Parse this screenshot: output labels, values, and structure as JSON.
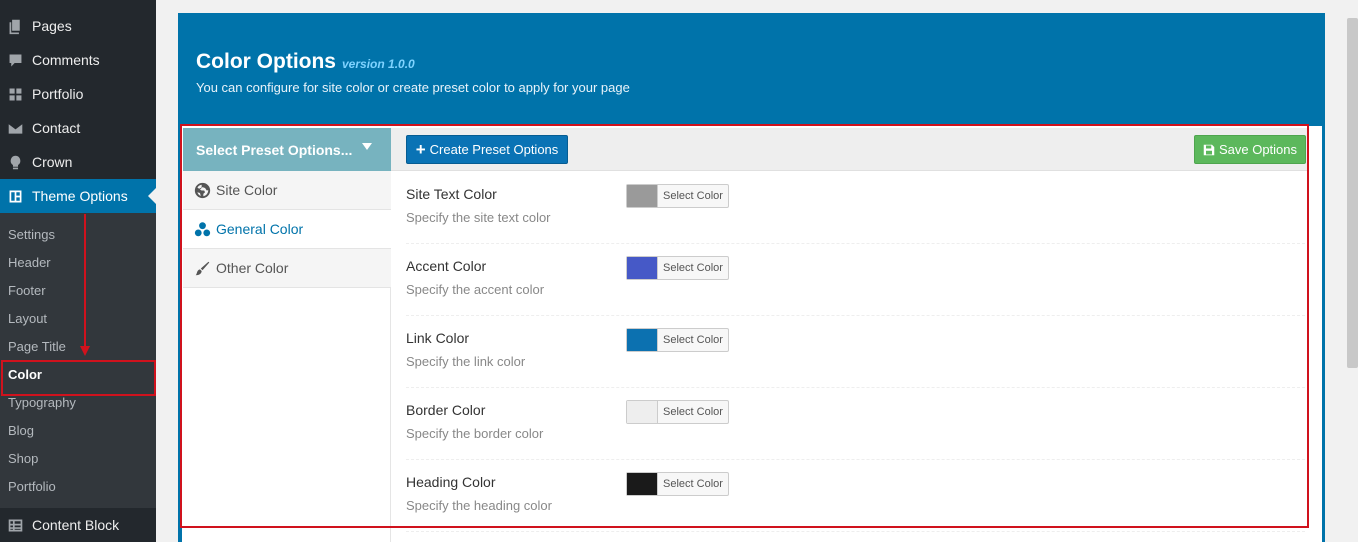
{
  "sidebar": {
    "menu": [
      {
        "label": "Pages",
        "icon": "pages-icon"
      },
      {
        "label": "Comments",
        "icon": "comment-icon"
      },
      {
        "label": "Portfolio",
        "icon": "grid-icon"
      },
      {
        "label": "Contact",
        "icon": "envelope-icon"
      },
      {
        "label": "Crown",
        "icon": "lightbulb-icon"
      },
      {
        "label": "Theme Options",
        "icon": "layout-icon",
        "current": true
      }
    ],
    "submenu": [
      "Settings",
      "Header",
      "Footer",
      "Layout",
      "Page Title",
      "Color",
      "Typography",
      "Blog",
      "Shop",
      "Portfolio"
    ],
    "active_submenu": "Color",
    "bottom_menu": {
      "label": "Content Block",
      "icon": "table-icon"
    }
  },
  "header": {
    "title": "Color Options",
    "version": "version 1.0.0",
    "description": "You can configure for site color or create preset color to apply for your page"
  },
  "toolbar": {
    "preset_select": "Select Preset Options...",
    "create_button": "Create Preset Options",
    "save_button": "Save Options"
  },
  "tabs": [
    {
      "label": "Site Color",
      "icon": "globe-icon",
      "active": false
    },
    {
      "label": "General Color",
      "icon": "circles-icon",
      "active": true
    },
    {
      "label": "Other Color",
      "icon": "brush-icon",
      "active": false
    }
  ],
  "options": [
    {
      "title": "Site Text Color",
      "description": "Specify the site text color",
      "color": "#9a9a9a",
      "picker_label": "Select Color"
    },
    {
      "title": "Accent Color",
      "description": "Specify the accent color",
      "color": "#4659c7",
      "picker_label": "Select Color"
    },
    {
      "title": "Link Color",
      "description": "Specify the link color",
      "color": "#0c71b0",
      "picker_label": "Select Color"
    },
    {
      "title": "Border Color",
      "description": "Specify the border color",
      "color": "#eeeeee",
      "picker_label": "Select Color"
    },
    {
      "title": "Heading Color",
      "description": "Specify the heading color",
      "color": "#1a1a1a",
      "picker_label": "Select Color"
    }
  ],
  "colors": {
    "admin_blue": "#0073aa",
    "sidebar_bg": "#23282d",
    "submenu_bg": "#32373c",
    "annotation_red": "#d0121d",
    "save_green": "#5cb85c",
    "preset_teal": "#77b3bf"
  }
}
